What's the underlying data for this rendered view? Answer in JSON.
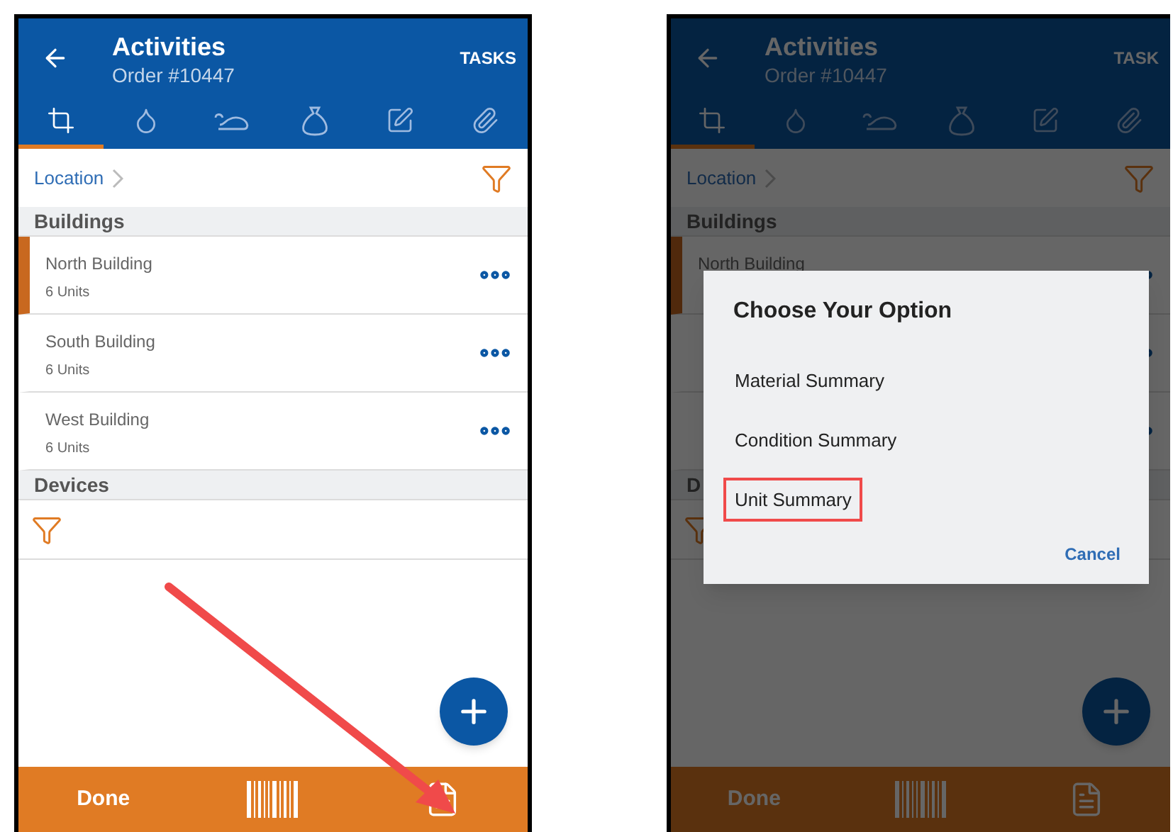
{
  "screens": [
    {
      "header": {
        "title": "Activities",
        "subtitle": "Order #10447",
        "action": "TASKS"
      },
      "tabs": [
        {
          "selected": true
        },
        {
          "selected": false
        },
        {
          "selected": false
        },
        {
          "selected": false
        },
        {
          "selected": false
        },
        {
          "selected": false
        }
      ],
      "breadcrumb": "Location",
      "sections": [
        {
          "title": "Buildings",
          "kind": "list",
          "items": [
            {
              "name": "North Building",
              "units": "6 Units",
              "selected": true
            },
            {
              "name": "South Building",
              "units": "6 Units",
              "selected": false
            },
            {
              "name": "West Building",
              "units": "6 Units",
              "selected": false
            }
          ]
        },
        {
          "title": "Devices",
          "kind": "filter"
        }
      ],
      "bottom_bar": {
        "done": "Done"
      },
      "arrow": true
    },
    {
      "header": {
        "title": "Activities",
        "subtitle": "Order #10447",
        "action": "TASK"
      },
      "tabs": [
        {
          "selected": true
        },
        {
          "selected": false
        },
        {
          "selected": false
        },
        {
          "selected": false
        },
        {
          "selected": false
        },
        {
          "selected": false
        }
      ],
      "breadcrumb": "Location",
      "sections": [
        {
          "title": "Buildings",
          "kind": "list",
          "items": [
            {
              "name": "North Building",
              "selected": true
            },
            {
              "selected": false
            },
            {
              "selected": false
            }
          ]
        },
        {
          "title": "D",
          "kind": "filter"
        }
      ],
      "bottom_bar": {
        "done": "Done"
      },
      "arrow": false,
      "dialog": {
        "title": "Choose Your Option",
        "options": [
          {
            "label": "Material Summary",
            "highlighted": false
          },
          {
            "label": "Condition Summary",
            "highlighted": false
          },
          {
            "label": "Unit Summary",
            "highlighted": true
          }
        ],
        "cancel": "Cancel"
      }
    }
  ]
}
